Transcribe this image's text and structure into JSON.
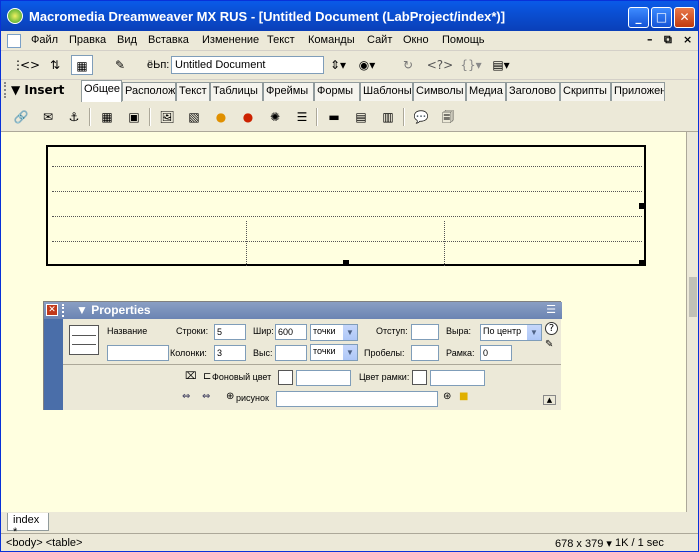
{
  "window": {
    "title": "Macromedia Dreamweaver MX RUS - [Untitled Document (LabProject/index*)]",
    "controls": {
      "minimize": "_",
      "maximize": "□",
      "close": "✕"
    }
  },
  "menubar": {
    "items": [
      "Файл",
      "Правка",
      "Вид",
      "Вставка",
      "Изменение",
      "Текст",
      "Команды",
      "Сайт",
      "Окно",
      "Помощь"
    ],
    "mdi_controls": {
      "minimize": "–",
      "restore": "⧉",
      "close": "×"
    }
  },
  "doc_toolbar": {
    "title_label": "ёЬп:",
    "title_value": "Untitled Document"
  },
  "insert_bar": {
    "heading": "Insert",
    "tabs": [
      "Общее",
      "Располож",
      "Текст",
      "Таблицы",
      "Фреймы",
      "Формы",
      "Шаблоны",
      "Символы",
      "Медиа",
      "Заголово",
      "Скрипты",
      "Приложен"
    ],
    "active_tab": "Общее"
  },
  "properties": {
    "title": "Properties",
    "name_label": "Название",
    "rows_label": "Строки:",
    "rows_value": "5",
    "width_label": "Шир:",
    "width_value": "600",
    "width_unit": "точки",
    "cellpad_label": "Отступ:",
    "cellpad_value": "",
    "align_label": "Выра:",
    "align_value": "По центр",
    "cols_label": "Колонки:",
    "cols_value": "3",
    "height_label": "Выс:",
    "height_value": "",
    "height_unit": "точки",
    "cellspace_label": "Пробелы:",
    "cellspace_value": "",
    "border_label": "Рамка:",
    "border_value": "0",
    "bgcolor_label": "Фоновый цвет",
    "bordercolor_label": "Цвет рамки:",
    "bgimage_label": "рисунок",
    "help": "?"
  },
  "document": {
    "tab_label": "index *"
  },
  "status_bar": {
    "tag_selector": "<body> <table>",
    "window_size": "678 x 379",
    "download": "1K / 1 sec"
  },
  "colors": {
    "titlebar": "#0a4fd3",
    "design_bg": "#ffffe0",
    "chrome": "#ece9d8"
  }
}
